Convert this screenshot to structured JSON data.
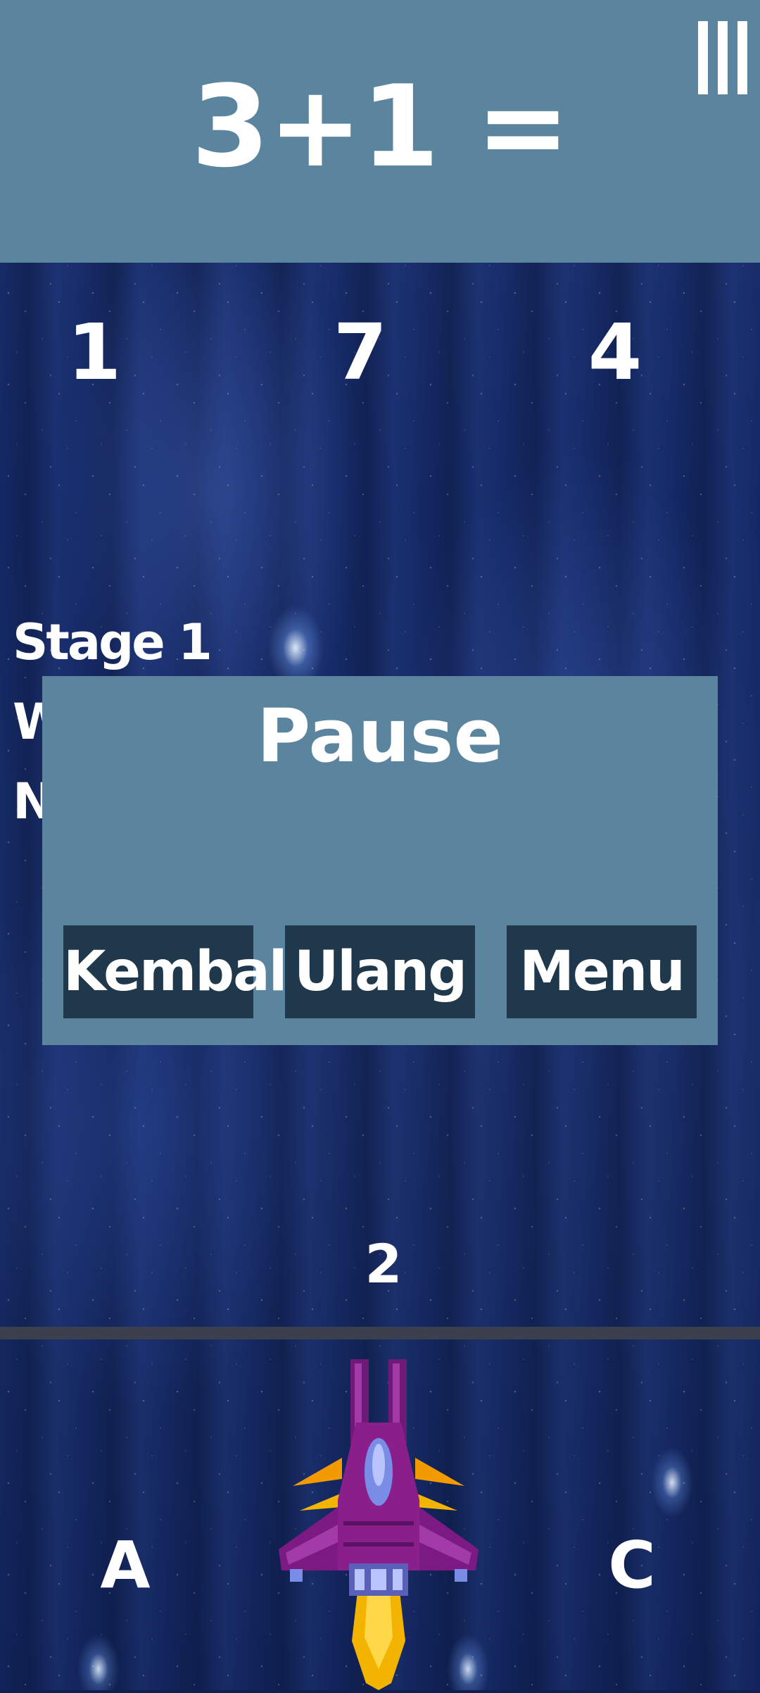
{
  "question": {
    "text": "3+1 ="
  },
  "menu_icon": {
    "name": "menu-bars-icon"
  },
  "answers": [
    "1",
    "7",
    "4"
  ],
  "hud": {
    "stage": "Stage 1",
    "line2_visible": "W",
    "line3_visible": "Ny"
  },
  "pause_dialog": {
    "title": "Pause",
    "buttons": {
      "resume": "Kembali",
      "restart": "Ulang",
      "menu": "Menu"
    }
  },
  "falling_number": "2",
  "lanes": {
    "left": "A",
    "right": "C"
  },
  "colors": {
    "panel": "#5b849e",
    "button": "#1f384b",
    "divider": "#3c3f4e",
    "ship_body": "#8a1f8c",
    "ship_flame": "#f2b400"
  }
}
